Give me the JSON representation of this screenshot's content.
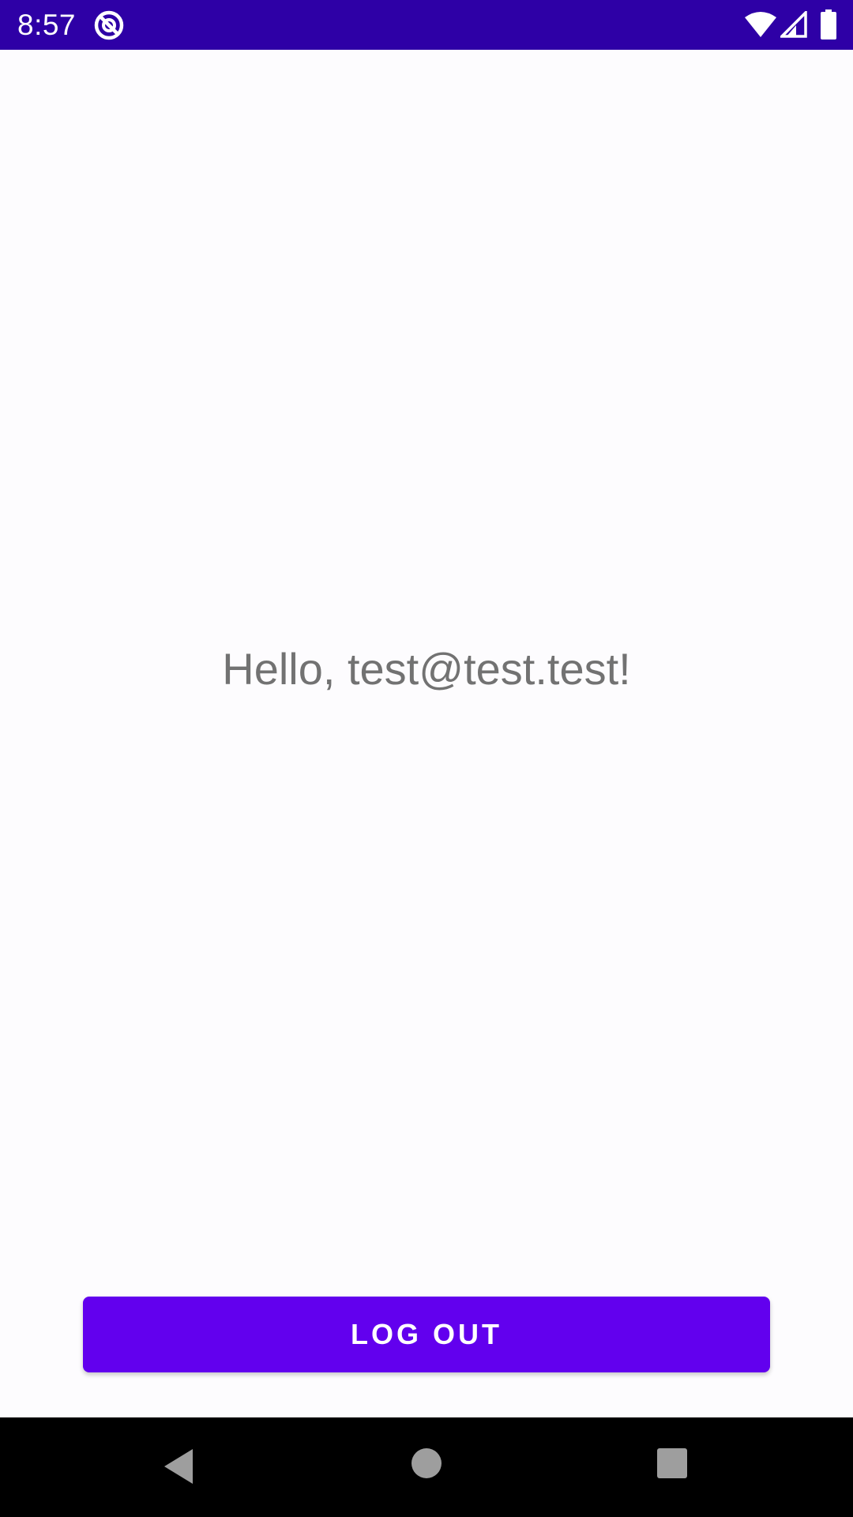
{
  "status_bar": {
    "time": "8:57",
    "background_color": "#2e00a6",
    "icons": [
      "do-not-disturb-icon",
      "wifi-icon",
      "cell-signal-icon",
      "battery-icon"
    ]
  },
  "main": {
    "greeting": "Hello, test@test.test!"
  },
  "actions": {
    "logout_label": "LOG OUT",
    "logout_color": "#6200ee"
  },
  "nav_bar": {
    "icons": [
      "back-icon",
      "home-icon",
      "recents-icon"
    ]
  }
}
